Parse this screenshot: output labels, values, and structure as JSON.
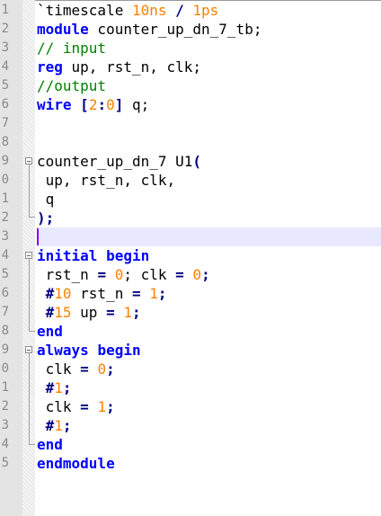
{
  "gutter": {
    "line_numbers": [
      "1",
      "2",
      "3",
      "4",
      "5",
      "6",
      "7",
      "8",
      "9",
      "0",
      "1",
      "2",
      "3",
      "4",
      "5",
      "6",
      "7",
      "8",
      "9",
      "0",
      "1",
      "2",
      "3",
      "4",
      "5"
    ]
  },
  "code": {
    "l1": {
      "a": "`timescale ",
      "b": "10ns",
      "c": " / ",
      "d": "1ps"
    },
    "l2": {
      "kw": "module",
      "rest": " counter_up_dn_7_tb;"
    },
    "l3": {
      "cm": "// input"
    },
    "l4": {
      "kw": "reg",
      "rest": " up, rst_n, clk;"
    },
    "l5": {
      "cm": "//output"
    },
    "l6": {
      "kw": "wire",
      "sp": " ",
      "lb": "[",
      "n1": "2",
      "colon": ":",
      "n2": "0",
      "rb": "]",
      "rest": " q;"
    },
    "l9": {
      "text": "counter_up_dn_7 U1",
      "paren": "("
    },
    "l10": {
      "text": " up, rst_n, clk,"
    },
    "l11": {
      "text": " q"
    },
    "l12": {
      "text": ");"
    },
    "l14": {
      "kw1": "initial",
      "sp": " ",
      "kw2": "begin"
    },
    "l15": {
      "a": " rst_n ",
      "eq1": "=",
      "sp1": " ",
      "n1": "0",
      "b": "; clk ",
      "eq2": "=",
      "sp2": " ",
      "n2": "0",
      "c": ";"
    },
    "l16": {
      "hash": " #",
      "n": "10",
      "a": " rst_n ",
      "eq": "=",
      "sp": " ",
      "n2": "1",
      "c": ";"
    },
    "l17": {
      "hash": " #",
      "n": "15",
      "a": " up ",
      "eq": "=",
      "sp": " ",
      "n2": "1",
      "c": ";"
    },
    "l18": {
      "kw": "end"
    },
    "l19": {
      "kw1": "always",
      "sp": " ",
      "kw2": "begin"
    },
    "l20": {
      "a": " clk ",
      "eq": "=",
      "sp": " ",
      "n": "0",
      "c": ";"
    },
    "l21": {
      "hash": " #",
      "n": "1",
      "c": ";"
    },
    "l22": {
      "a": " clk ",
      "eq": "=",
      "sp": " ",
      "n": "1",
      "c": ";"
    },
    "l23": {
      "hash": " #",
      "n": "1",
      "c": ";"
    },
    "l24": {
      "kw": "end"
    },
    "l25": {
      "kw": "endmodule"
    }
  },
  "colors": {
    "keyword": "#0000ff",
    "comment": "#008000",
    "number": "#ff8000",
    "operator": "#000080",
    "current_line": "#e8e8ff",
    "gutter": "#e4e4e4"
  }
}
